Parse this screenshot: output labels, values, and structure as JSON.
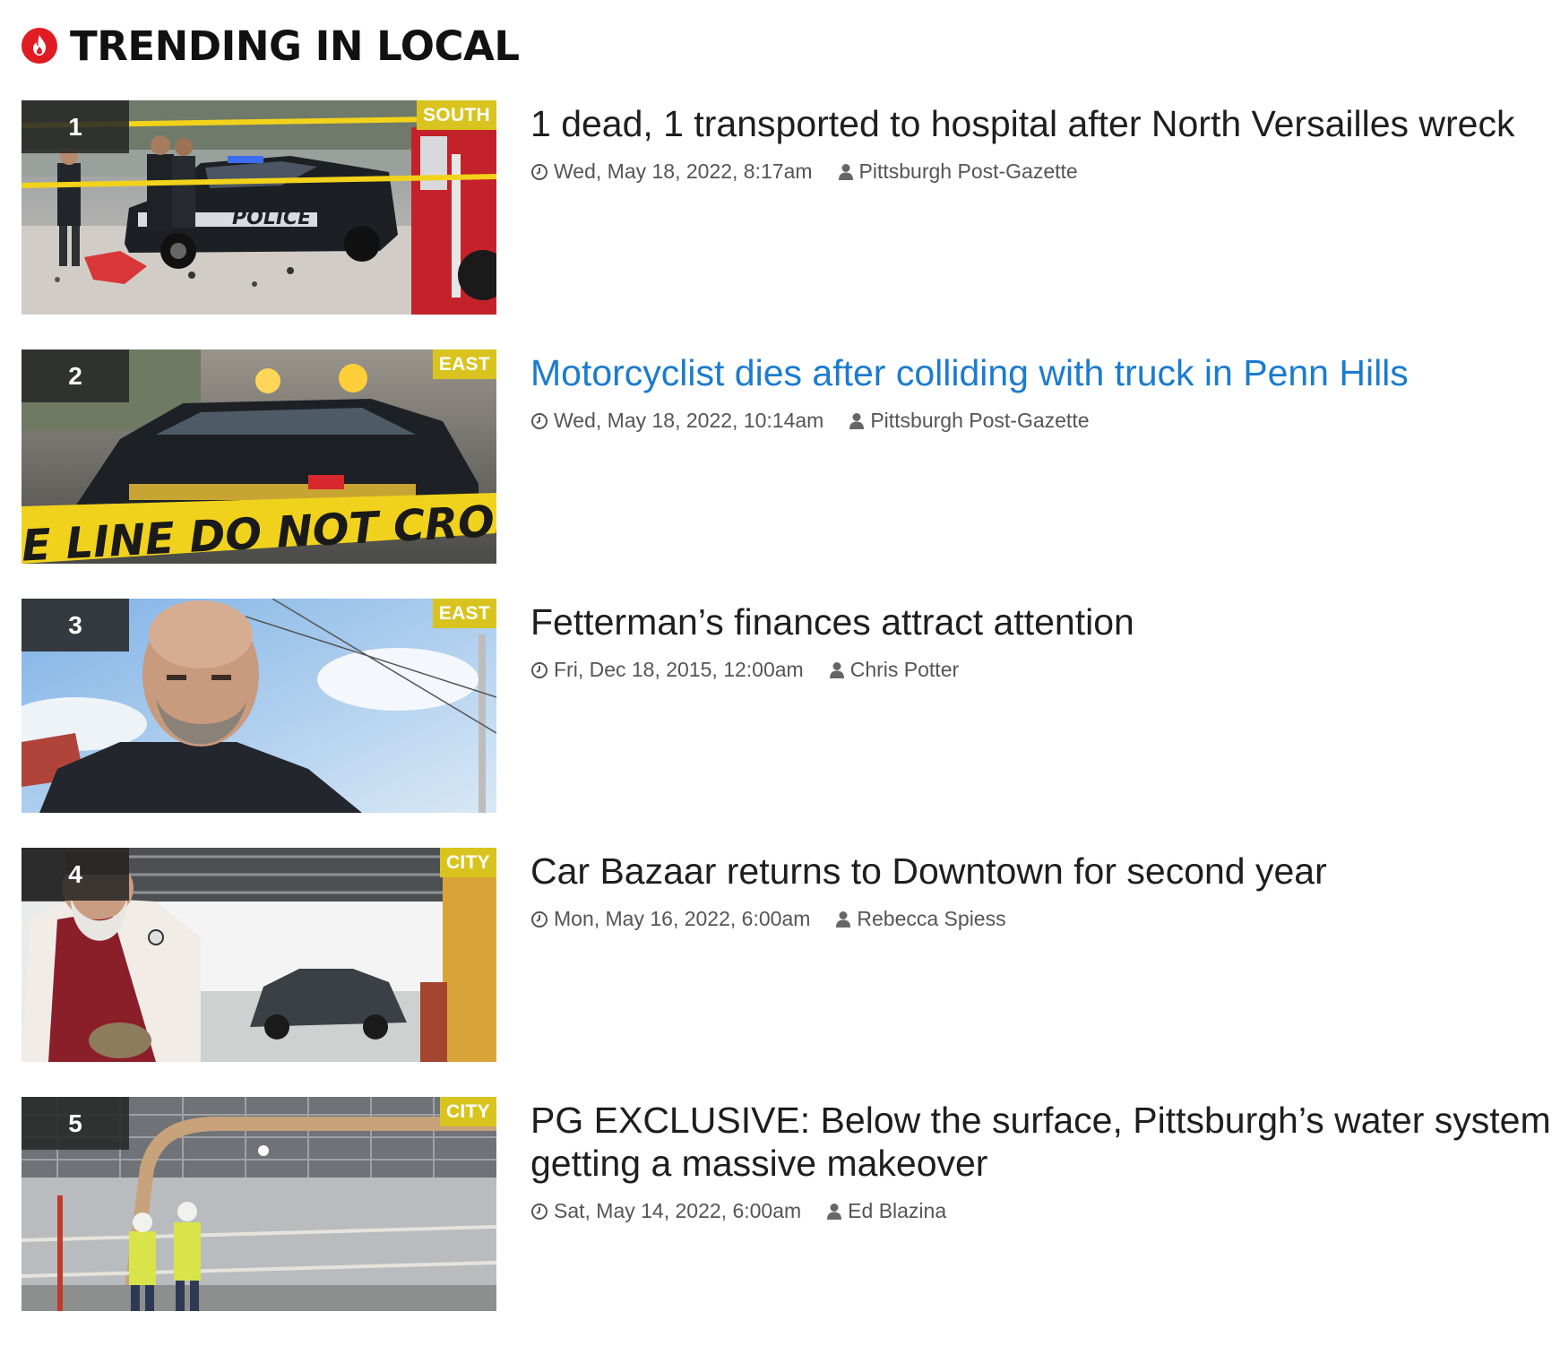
{
  "section": {
    "title": "TRENDING IN LOCAL",
    "icon": "flame-icon",
    "accent_color": "#e01b22"
  },
  "colors": {
    "link_active": "#1b7bd0",
    "region_badge": "#d9c41f",
    "rank_badge": "#2b2b2b"
  },
  "articles": [
    {
      "rank": "1",
      "region": "SOUTH",
      "headline": "1 dead, 1 transported to hospital after North Versailles wreck",
      "date": "Wed, May 18, 2022, 8:17am",
      "author": "Pittsburgh Post-Gazette",
      "thumbnail": "police-car-crash-scene"
    },
    {
      "rank": "2",
      "region": "EAST",
      "headline": "Motorcyclist dies after colliding with truck in Penn Hills",
      "date": "Wed, May 18, 2022, 10:14am",
      "author": "Pittsburgh Post-Gazette",
      "thumbnail": "police-tape-do-not-cross",
      "tape_text": "E LINE DO NOT CROSS"
    },
    {
      "rank": "3",
      "region": "EAST",
      "headline": "Fetterman’s finances attract attention",
      "date": "Fri, Dec 18, 2015, 12:00am",
      "author": "Chris Potter",
      "thumbnail": "bald-bearded-man-portrait"
    },
    {
      "rank": "4",
      "region": "CITY",
      "headline": "Car Bazaar returns to Downtown for second year",
      "date": "Mon, May 16, 2022, 6:00am",
      "author": "Rebecca Spiess",
      "thumbnail": "priest-blessing-car-garage"
    },
    {
      "rank": "5",
      "region": "CITY",
      "headline": "PG EXCLUSIVE: Below the surface, Pittsburgh’s water system getting a massive makeover",
      "date": "Sat, May 14, 2022, 6:00am",
      "author": "Ed Blazina",
      "thumbnail": "water-plant-workers-pipes"
    }
  ]
}
